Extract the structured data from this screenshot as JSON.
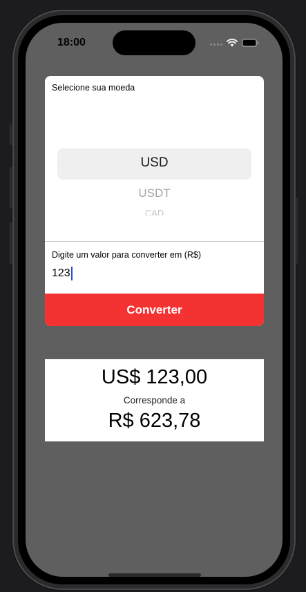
{
  "status_bar": {
    "time": "18:00"
  },
  "picker": {
    "label": "Selecione sua moeda",
    "selected": "USD",
    "options_below": [
      "USDT",
      "CAD"
    ]
  },
  "amount": {
    "label": "Digite um valor para converter em (R$)",
    "value": "123"
  },
  "convert_button": {
    "label": "Converter"
  },
  "result": {
    "foreign_value": "US$ 123,00",
    "caption": "Corresponde a",
    "brl_value": "R$ 623,78"
  },
  "colors": {
    "button": "#f43232",
    "screen_background": "#5f5f5f",
    "caret": "#2c4bd6"
  },
  "icons": [
    "signal-icon",
    "wifi-icon",
    "battery-icon"
  ]
}
